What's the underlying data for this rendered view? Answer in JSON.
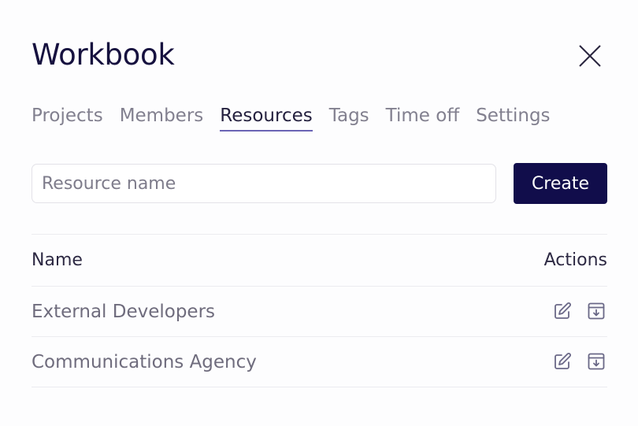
{
  "dialog": {
    "title": "Workbook",
    "close_icon": "close-icon"
  },
  "tabs": [
    {
      "label": "Projects",
      "active": false
    },
    {
      "label": "Members",
      "active": false
    },
    {
      "label": "Resources",
      "active": true
    },
    {
      "label": "Tags",
      "active": false
    },
    {
      "label": "Time off",
      "active": false
    },
    {
      "label": "Settings",
      "active": false
    }
  ],
  "form": {
    "input_placeholder": "Resource name",
    "input_value": "",
    "create_label": "Create"
  },
  "table": {
    "headers": {
      "name": "Name",
      "actions": "Actions"
    },
    "rows": [
      {
        "name": "External Developers",
        "actions": [
          "edit-icon",
          "archive-icon"
        ]
      },
      {
        "name": "Communications Agency",
        "actions": [
          "edit-icon",
          "archive-icon"
        ]
      }
    ]
  },
  "colors": {
    "accent": "#110d4b",
    "tab_underline": "#6a64b5",
    "icon": "#6a6887"
  }
}
